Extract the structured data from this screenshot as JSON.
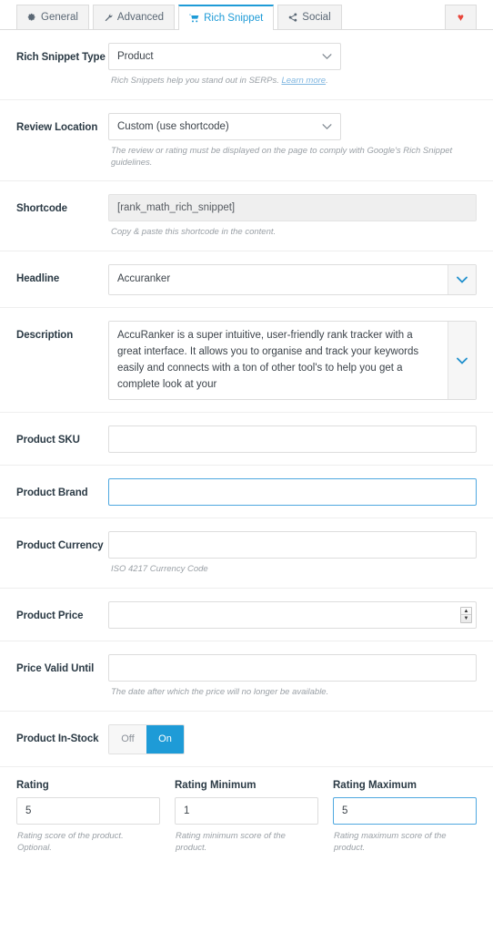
{
  "tabs": [
    {
      "id": "general",
      "label": "General",
      "icon": "gear-icon",
      "active": false
    },
    {
      "id": "advanced",
      "label": "Advanced",
      "icon": "wrench-icon",
      "active": false
    },
    {
      "id": "rich-snippet",
      "label": "Rich Snippet",
      "icon": "cart-icon",
      "active": true
    },
    {
      "id": "social",
      "label": "Social",
      "icon": "share-icon",
      "active": false
    }
  ],
  "favorite": {
    "icon": "heart-icon",
    "glyph": "♥",
    "color": "#e8463b"
  },
  "colors": {
    "accent": "#1e9bd7",
    "focus": "#4fa8e0",
    "heart": "#e8463b",
    "link": "#7fb6e0"
  },
  "fields": {
    "snippet_type": {
      "label": "Rich Snippet Type",
      "value": "Product",
      "help_before": "Rich Snippets help you stand out in SERPs.",
      "help_link": "Learn more",
      "help_after": "."
    },
    "review_location": {
      "label": "Review Location",
      "value": "Custom (use shortcode)",
      "help": "The review or rating must be displayed on the page to comply with Google's Rich Snippet guidelines."
    },
    "shortcode": {
      "label": "Shortcode",
      "value": "[rank_math_rich_snippet]",
      "help": "Copy & paste this shortcode in the content."
    },
    "headline": {
      "label": "Headline",
      "value": "Accuranker"
    },
    "description": {
      "label": "Description",
      "value": "AccuRanker is a super intuitive, user-friendly rank tracker with a great interface.  It allows you to organise and track your keywords easily and connects with a ton of other tool's to help you get a complete look at your"
    },
    "product_sku": {
      "label": "Product SKU",
      "value": "",
      "placeholder": ""
    },
    "product_brand": {
      "label": "Product Brand",
      "value": "",
      "placeholder": ""
    },
    "product_currency": {
      "label": "Product Currency",
      "value": "",
      "placeholder": "",
      "help": "ISO 4217 Currency Code"
    },
    "product_price": {
      "label": "Product Price",
      "value": "",
      "placeholder": ""
    },
    "price_valid_until": {
      "label": "Price Valid Until",
      "value": "",
      "placeholder": "",
      "help": "The date after which the price will no longer be available."
    },
    "product_in_stock": {
      "label": "Product In-Stock",
      "off_label": "Off",
      "on_label": "On",
      "state": "On"
    },
    "rating": {
      "label": "Rating",
      "value": "5",
      "help": "Rating score of the product. Optional."
    },
    "rating_minimum": {
      "label": "Rating Minimum",
      "value": "1",
      "help": "Rating minimum score of the product."
    },
    "rating_maximum": {
      "label": "Rating Maximum",
      "value": "5",
      "help": "Rating maximum score of the product."
    }
  }
}
